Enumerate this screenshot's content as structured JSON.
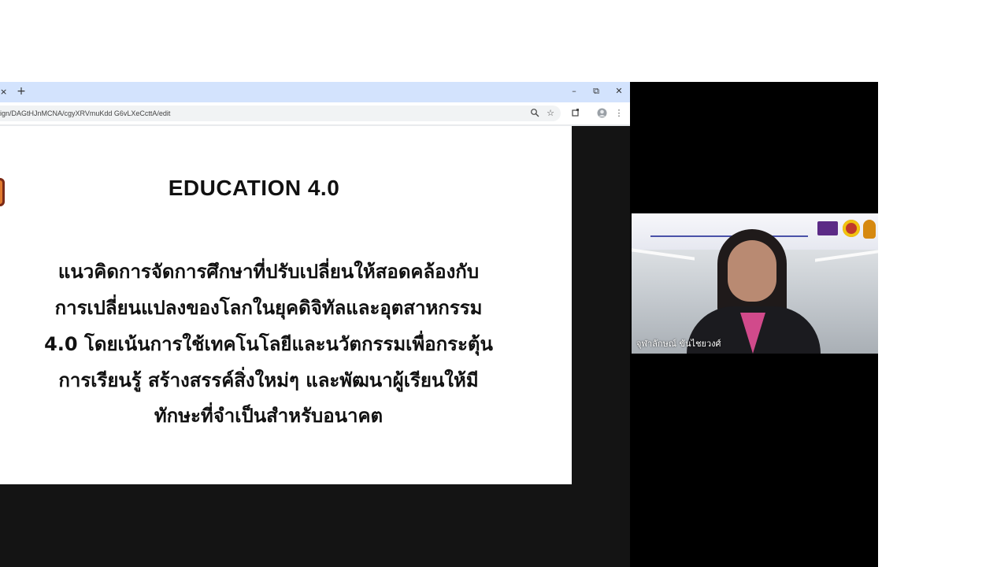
{
  "browser": {
    "tab_close_glyph": "×",
    "new_tab_glyph": "+",
    "window_controls": {
      "minimize": "–",
      "restore": "⧉",
      "close": "✕"
    },
    "url": "ign/DAGtHJnMCNA/cgyXRVmuKdd G6vLXeCcttA/edit",
    "toolbar_icons": [
      "zoom-icon",
      "star-icon",
      "extensions-icon",
      "profile-icon",
      "menu-icon"
    ]
  },
  "slide": {
    "title": "EDUCATION 4.0",
    "body_lines": [
      "แนวคิดการจัดการศึกษาที่ปรับเปลี่ยนให้สอดคล้องกับ",
      "การเปลี่ยนแปลงของโลกในยุคดิจิทัลและอุตสาหกรรม",
      "4.0 โดยเน้นการใช้เทคโนโลยีและนวัตกรรมเพื่อกระตุ้น",
      "การเรียนรู้ สร้างสรรค์สิ่งใหม่ๆ และพัฒนาผู้เรียนให้มี",
      "ทักษะที่จำเป็นสำหรับอนาคต"
    ]
  },
  "participant": {
    "name": "จุฬาลักษณ์ ขันไชยวงศ์"
  },
  "colors": {
    "tabbar": "#d3e3fd",
    "meeting_background": "#000000",
    "slide_background": "#ffffff"
  }
}
